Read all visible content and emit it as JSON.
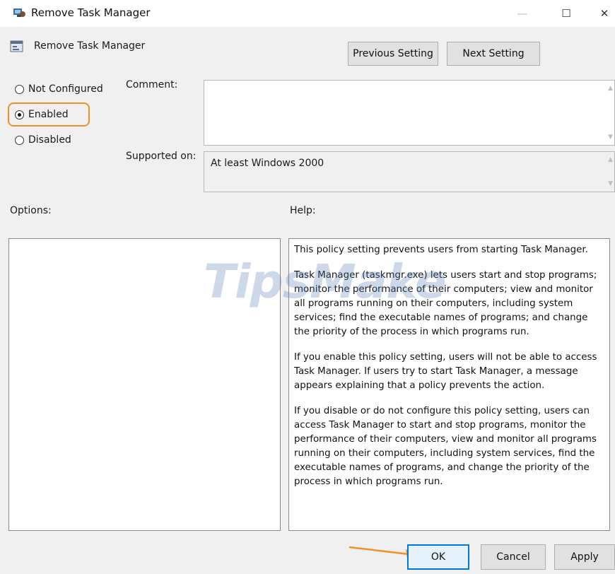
{
  "window": {
    "title": "Remove Task Manager",
    "controls": {
      "minimize": "—",
      "maximize": "☐",
      "close": "✕"
    }
  },
  "header": {
    "setting_name": "Remove Task Manager",
    "previous_label": "Previous Setting",
    "next_label": "Next Setting"
  },
  "state": {
    "options": [
      {
        "label": "Not Configured",
        "checked": false
      },
      {
        "label": "Enabled",
        "checked": true
      },
      {
        "label": "Disabled",
        "checked": false
      }
    ]
  },
  "fields": {
    "comment_label": "Comment:",
    "comment_value": "",
    "supported_label": "Supported on:",
    "supported_value": "At least Windows 2000"
  },
  "sections": {
    "options_label": "Options:",
    "help_label": "Help:"
  },
  "help": {
    "paragraphs": [
      "This policy setting prevents users from starting Task Manager.",
      "Task Manager (taskmgr.exe) lets users start and stop programs; monitor the performance of their computers; view and monitor all programs running on their computers, including system services; find the executable names of programs; and change the priority of the process in which programs run.",
      "If you enable this policy setting, users will not be able to access Task Manager. If users try to start Task Manager, a message appears explaining that a policy prevents the action.",
      "If you disable or do not configure this policy setting, users can access Task Manager to  start and stop programs, monitor the performance of their computers, view and monitor all programs running on their computers, including system services, find the executable names of programs, and change the priority of the process in which programs run."
    ]
  },
  "footer": {
    "ok_label": "OK",
    "cancel_label": "Cancel",
    "apply_label": "Apply"
  },
  "watermark": "TipsMake",
  "colors": {
    "highlight": "#f0902a",
    "accent": "#0078d7"
  }
}
